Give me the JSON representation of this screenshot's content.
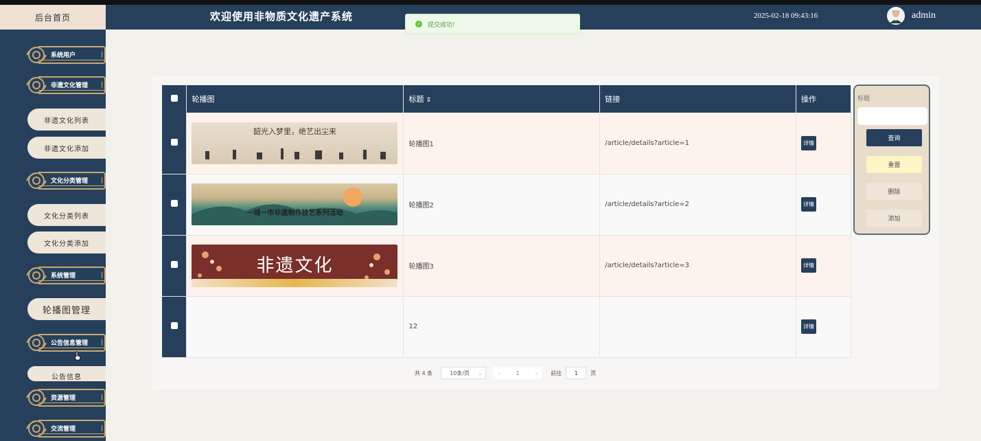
{
  "header": {
    "home_tab": "后台首页",
    "title": "欢迎使用非物质文化遗产系统",
    "datetime": "2025-02-18 09:43:16",
    "username": "admin"
  },
  "toast": {
    "message": "提交成功!"
  },
  "sidebar": {
    "groups": [
      {
        "label": "系统用户"
      },
      {
        "label": "非遗文化管理"
      },
      {
        "label": "文化分类管理"
      },
      {
        "label": "系统管理"
      },
      {
        "label": "公告信息管理"
      },
      {
        "label": "资源管理"
      },
      {
        "label": "交流管理"
      }
    ],
    "sub_items": [
      {
        "label": "非遗文化列表"
      },
      {
        "label": "非遗文化添加"
      },
      {
        "label": "文化分类列表"
      },
      {
        "label": "文化分类添加"
      },
      {
        "label": "轮播图管理"
      },
      {
        "label": "公告信息"
      }
    ]
  },
  "table": {
    "columns": [
      "轮播图",
      "标题",
      "链接",
      "操作"
    ],
    "detail_label": "详情",
    "rows": [
      {
        "title": "轮播图1",
        "link": "/article/details?article=1",
        "banner_text": "韶光入梦里，绝艺出尘来"
      },
      {
        "title": "轮播图2",
        "link": "/article/details?article=2",
        "banner_text": "一城一市非遗制作技艺系列活动"
      },
      {
        "title": "轮播图3",
        "link": "/article/details?article=3",
        "banner_text": "非遗文化"
      },
      {
        "title": "12",
        "link": "",
        "banner_text": ""
      }
    ]
  },
  "search": {
    "label": "标题",
    "query_btn": "查询",
    "reset_btn": "重置",
    "delete_btn": "删除",
    "add_btn": "添加"
  },
  "pagination": {
    "total": "共 4 条",
    "page_size": "10条/页",
    "current_page": "1",
    "goto_label": "前往",
    "goto_value": "1",
    "page_unit": "页"
  },
  "colors": {
    "primary": "#26405c",
    "accent_gold": "#c9a96e",
    "row_odd": "#fdf3ec"
  }
}
